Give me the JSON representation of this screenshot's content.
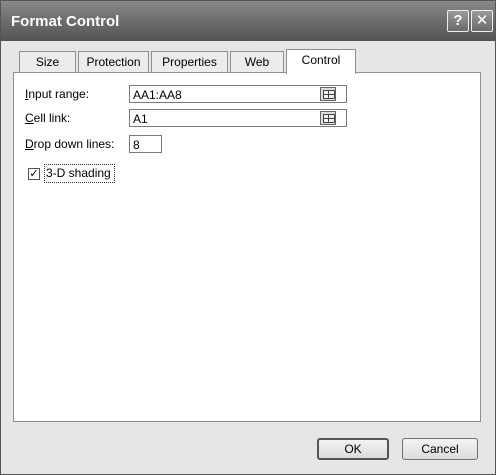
{
  "window": {
    "title": "Format Control",
    "help_label": "?",
    "close_label": "✕"
  },
  "tabs": [
    {
      "label": "Size"
    },
    {
      "label": "Protection"
    },
    {
      "label": "Properties"
    },
    {
      "label": "Web"
    },
    {
      "label": "Control"
    }
  ],
  "control": {
    "input_range": {
      "label_first": "I",
      "label_rest": "nput range:",
      "value": "AA1:AA8"
    },
    "cell_link": {
      "label_first": "C",
      "label_rest": "ell link:",
      "value": "A1"
    },
    "drop_down_lines": {
      "label_first": "D",
      "label_rest": "rop down lines:",
      "value": "8"
    },
    "shading": {
      "checked": true,
      "check_glyph": "✓",
      "label": "3-D shading"
    }
  },
  "buttons": {
    "ok": "OK",
    "cancel": "Cancel"
  },
  "colors": {
    "titlebar": "#6f6f6f",
    "dialog": "#e6e6e6",
    "panel": "#ffffff"
  }
}
